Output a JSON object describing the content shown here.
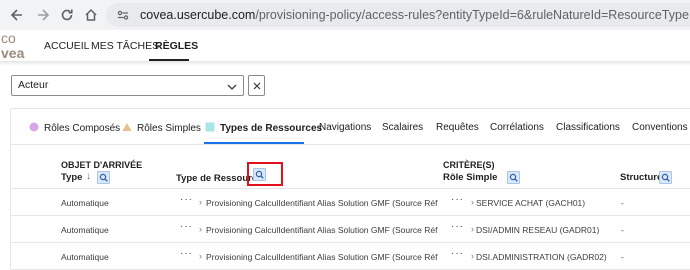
{
  "browser": {
    "url_domain": "covea.usercube.com",
    "url_path": "/provisioning-policy/access-rules?entityTypeId=6&ruleNatureId=ResourceType"
  },
  "app": {
    "logo_text_top": "co",
    "logo_text_bottom": "vea",
    "menu": [
      {
        "label": "ACCUEIL"
      },
      {
        "label": "MES TÂCHES"
      },
      {
        "label": "RÈGLES"
      }
    ]
  },
  "filter": {
    "selected": "Acteur"
  },
  "tabs": [
    {
      "label": "Rôles Composés",
      "icon": "circle-icon",
      "color": "#d7a8e8"
    },
    {
      "label": "Rôles Simples",
      "icon": "triangle-icon",
      "color": "#e8c08a"
    },
    {
      "label": "Types de Ressources",
      "icon": "square-icon",
      "color": "#a8e4ea"
    },
    {
      "label": "Navigations"
    },
    {
      "label": "Scalaires"
    },
    {
      "label": "Requêtes"
    },
    {
      "label": "Corrélations"
    },
    {
      "label": "Classifications"
    },
    {
      "label": "Conventions de"
    }
  ],
  "table": {
    "group_target": "OBJET D'ARRIVÉE",
    "group_criteria": "CRITÈRE(S)",
    "col_type": "Type",
    "col_resource_type": "Type de Ressource",
    "col_simple_role": "Rôle Simple",
    "col_structure": "Structure",
    "rows": [
      {
        "type": "Automatique",
        "dots": "···",
        "resource": "Provisioning CalculIdentifiant Alias Solution GMF (Source Réf",
        "dots2": "···",
        "role": "SERVICE ACHAT (GACH01)",
        "structure": "-"
      },
      {
        "type": "Automatique",
        "dots": "···",
        "resource": "Provisioning CalculIdentifiant Alias Solution GMF (Source Réf",
        "dots2": "···",
        "role": "DSI/ADMIN RESEAU (GADR01)",
        "structure": "-"
      },
      {
        "type": "Automatique",
        "dots": "···",
        "resource": "Provisioning CalculIdentifiant Alias Solution GMF (Source Réf",
        "dots2": "···",
        "role": "DSI.ADMINISTRATION (GADR02)",
        "structure": "-"
      }
    ]
  },
  "colors": {
    "accent": "#1a73e8",
    "highlight": "#e3101d"
  }
}
